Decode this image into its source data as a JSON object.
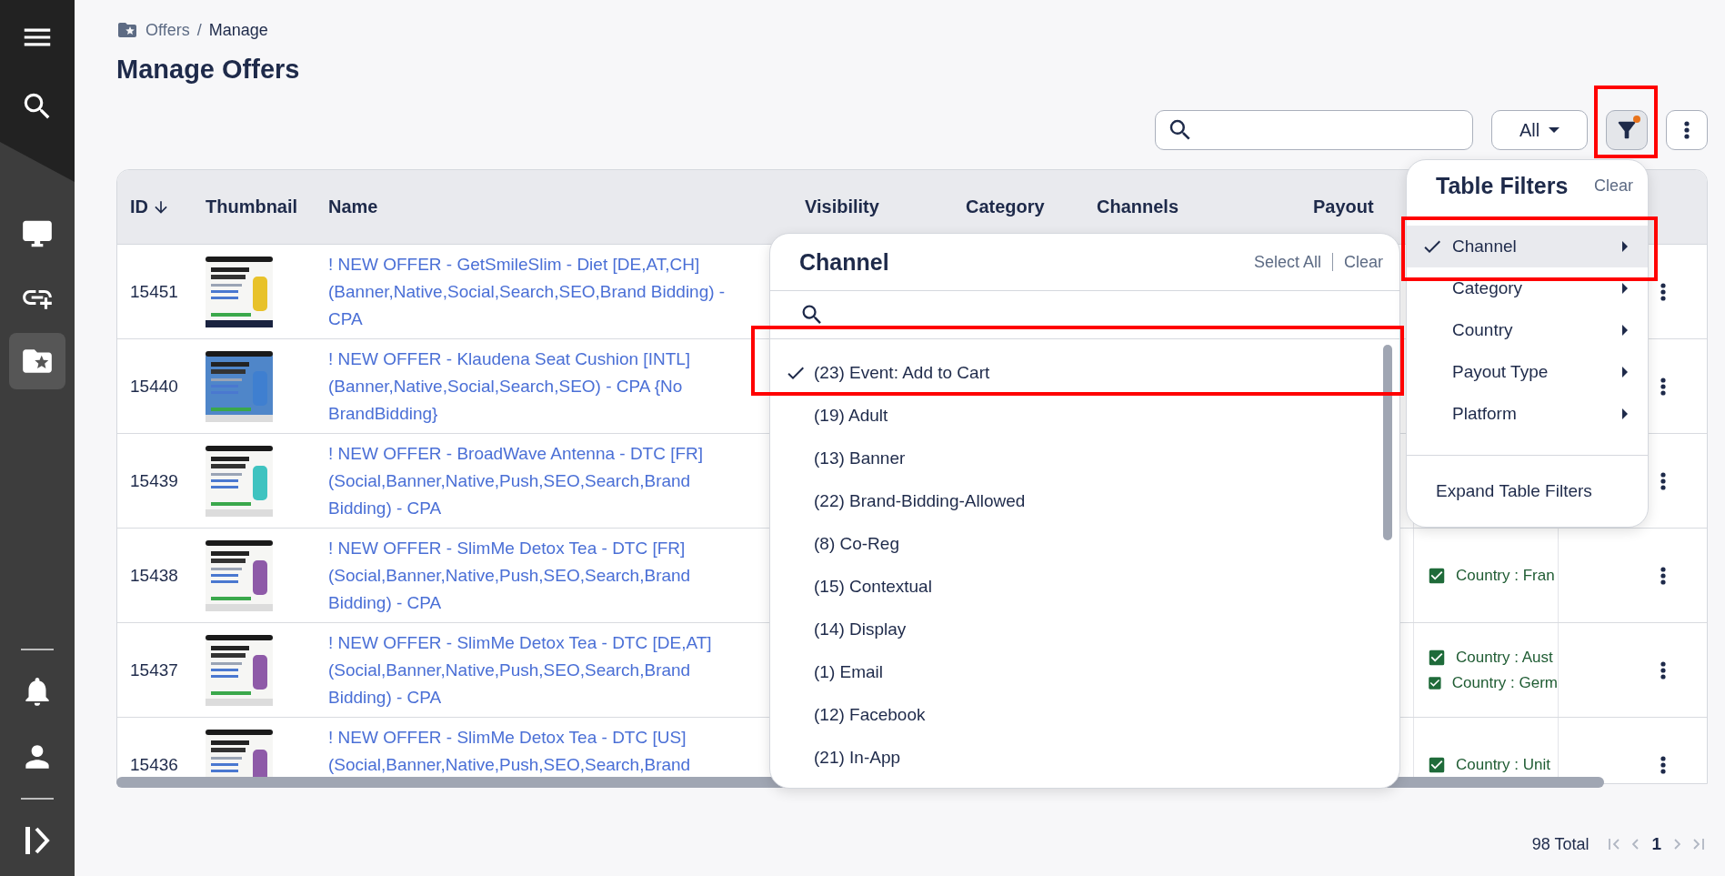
{
  "sidebar": {
    "top": [
      {
        "kind": "menu"
      },
      {
        "kind": "search"
      }
    ],
    "nav": [
      {
        "kind": "monitor",
        "selected": false
      },
      {
        "kind": "link-add",
        "selected": false
      },
      {
        "kind": "folder-star",
        "selected": true
      }
    ],
    "bottom": [
      {
        "kind": "bell"
      },
      {
        "kind": "person"
      }
    ],
    "collapse": {
      "kind": "collapse"
    }
  },
  "breadcrumb": {
    "items": [
      "Offers",
      "Manage"
    ],
    "separator": "/"
  },
  "title": "Manage Offers",
  "toolbar": {
    "view": "All",
    "filter_active": true
  },
  "table": {
    "columns": [
      {
        "label": "ID",
        "sorted_descending": true
      },
      {
        "label": "Thumbnail"
      },
      {
        "label": "Name"
      },
      {
        "label": "Visibility"
      },
      {
        "label": "Category"
      },
      {
        "label": "Channels"
      },
      {
        "label": "Payout"
      }
    ],
    "rows": [
      {
        "id": "15451",
        "name": "! NEW OFFER - GetSmileSlim - Diet [DE,AT,CH] (Banner,Native,Social,Search,SEO,Brand Bidding) - CPA"
      },
      {
        "id": "15440",
        "name": "! NEW OFFER - Klaudena Seat Cushion [INTL] (Banner,Native,Social,Search,SEO) - CPA {No BrandBidding}"
      },
      {
        "id": "15439",
        "name": "! NEW OFFER - BroadWave Antenna - DTC [FR] (Social,Banner,Native,Push,SEO,Search,Brand Bidding) - CPA"
      },
      {
        "id": "15438",
        "name": "! NEW OFFER - SlimMe Detox Tea - DTC [FR] (Social,Banner,Native,Push,SEO,Search,Brand Bidding) - CPA",
        "countries": [
          {
            "label": "Country : Fran",
            "checked": true
          }
        ]
      },
      {
        "id": "15437",
        "name": "! NEW OFFER - SlimMe Detox Tea - DTC [DE,AT] (Social,Banner,Native,Push,SEO,Search,Brand Bidding) - CPA",
        "countries": [
          {
            "label": "Country : Aust",
            "checked": true
          },
          {
            "label": "Country : Germ",
            "checked": true
          }
        ]
      },
      {
        "id": "15436",
        "name": "! NEW OFFER - SlimMe Detox Tea - DTC [US] (Social,Banner,Native,Push,SEO,Search,Brand",
        "countries": [
          {
            "label": "Country : Unit",
            "checked": true
          }
        ]
      }
    ]
  },
  "channel_filter": {
    "title": "Channel",
    "select_all": "Select All",
    "clear": "Clear",
    "options": [
      {
        "label": "(23) Event: Add to Cart",
        "checked": true
      },
      {
        "label": "(19) Adult",
        "checked": false
      },
      {
        "label": "(13) Banner",
        "checked": false
      },
      {
        "label": "(22) Brand-Bidding-Allowed",
        "checked": false
      },
      {
        "label": "(8) Co-Reg",
        "checked": false
      },
      {
        "label": "(15) Contextual",
        "checked": false
      },
      {
        "label": "(14) Display",
        "checked": false
      },
      {
        "label": "(1) Email",
        "checked": false
      },
      {
        "label": "(12) Facebook",
        "checked": false
      },
      {
        "label": "(21) In-App",
        "checked": false
      }
    ]
  },
  "table_filters": {
    "title": "Table Filters",
    "clear": "Clear",
    "items": [
      {
        "label": "Channel",
        "checked": true,
        "selected": true
      },
      {
        "label": "Category",
        "checked": false,
        "selected": false
      },
      {
        "label": "Country",
        "checked": false,
        "selected": false
      },
      {
        "label": "Payout Type",
        "checked": false,
        "selected": false
      },
      {
        "label": "Platform",
        "checked": false,
        "selected": false
      }
    ],
    "expand": "Expand Table Filters"
  },
  "pagination": {
    "total": "98 Total",
    "page": "1",
    "nav": [
      {
        "kind": "first",
        "disabled": true
      },
      {
        "kind": "prev",
        "disabled": true
      },
      {
        "kind": "next",
        "disabled": true
      },
      {
        "kind": "last",
        "disabled": true
      }
    ]
  }
}
